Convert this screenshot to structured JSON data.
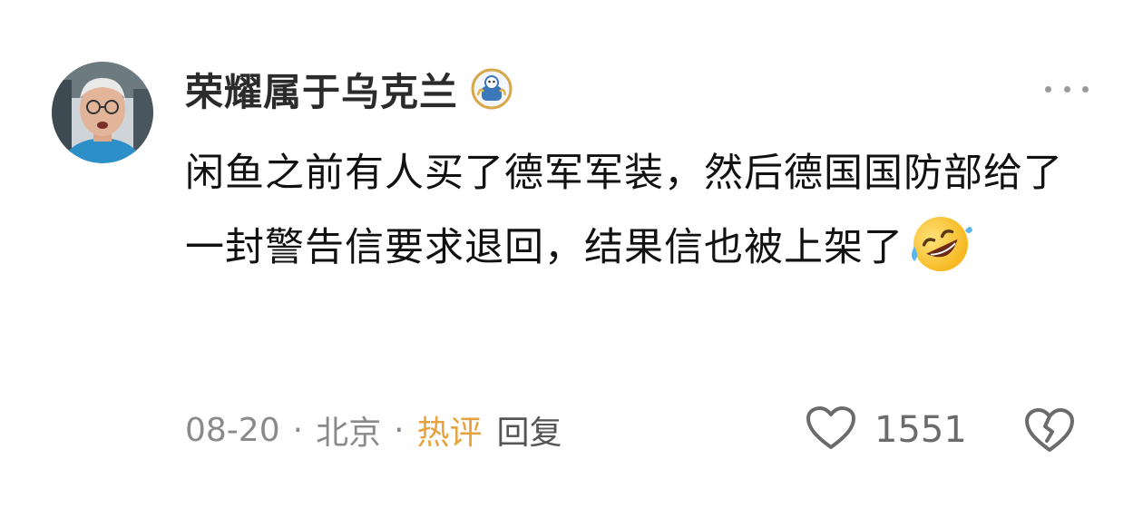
{
  "comment": {
    "username": "荣耀属于乌克兰",
    "text": "闲鱼之前有人买了德军军装，然后德国国防部给了一封警告信要求退回，结果信也被上架了",
    "emoji": "rolling-on-floor-laughing-emoji",
    "date": "08-20",
    "separator": "·",
    "location": "北京",
    "hot_label": "热评",
    "reply_label": "回复",
    "like_count": "1551"
  },
  "icons": {
    "fan_badge": "fan-badge-icon",
    "more": "more-dots-icon",
    "like": "heart-outline-icon",
    "dislike": "broken-heart-icon"
  },
  "colors": {
    "hot_label": "#e6a23c",
    "meta_text": "#8a8a8a",
    "icon_gray": "#6b6b6b"
  }
}
